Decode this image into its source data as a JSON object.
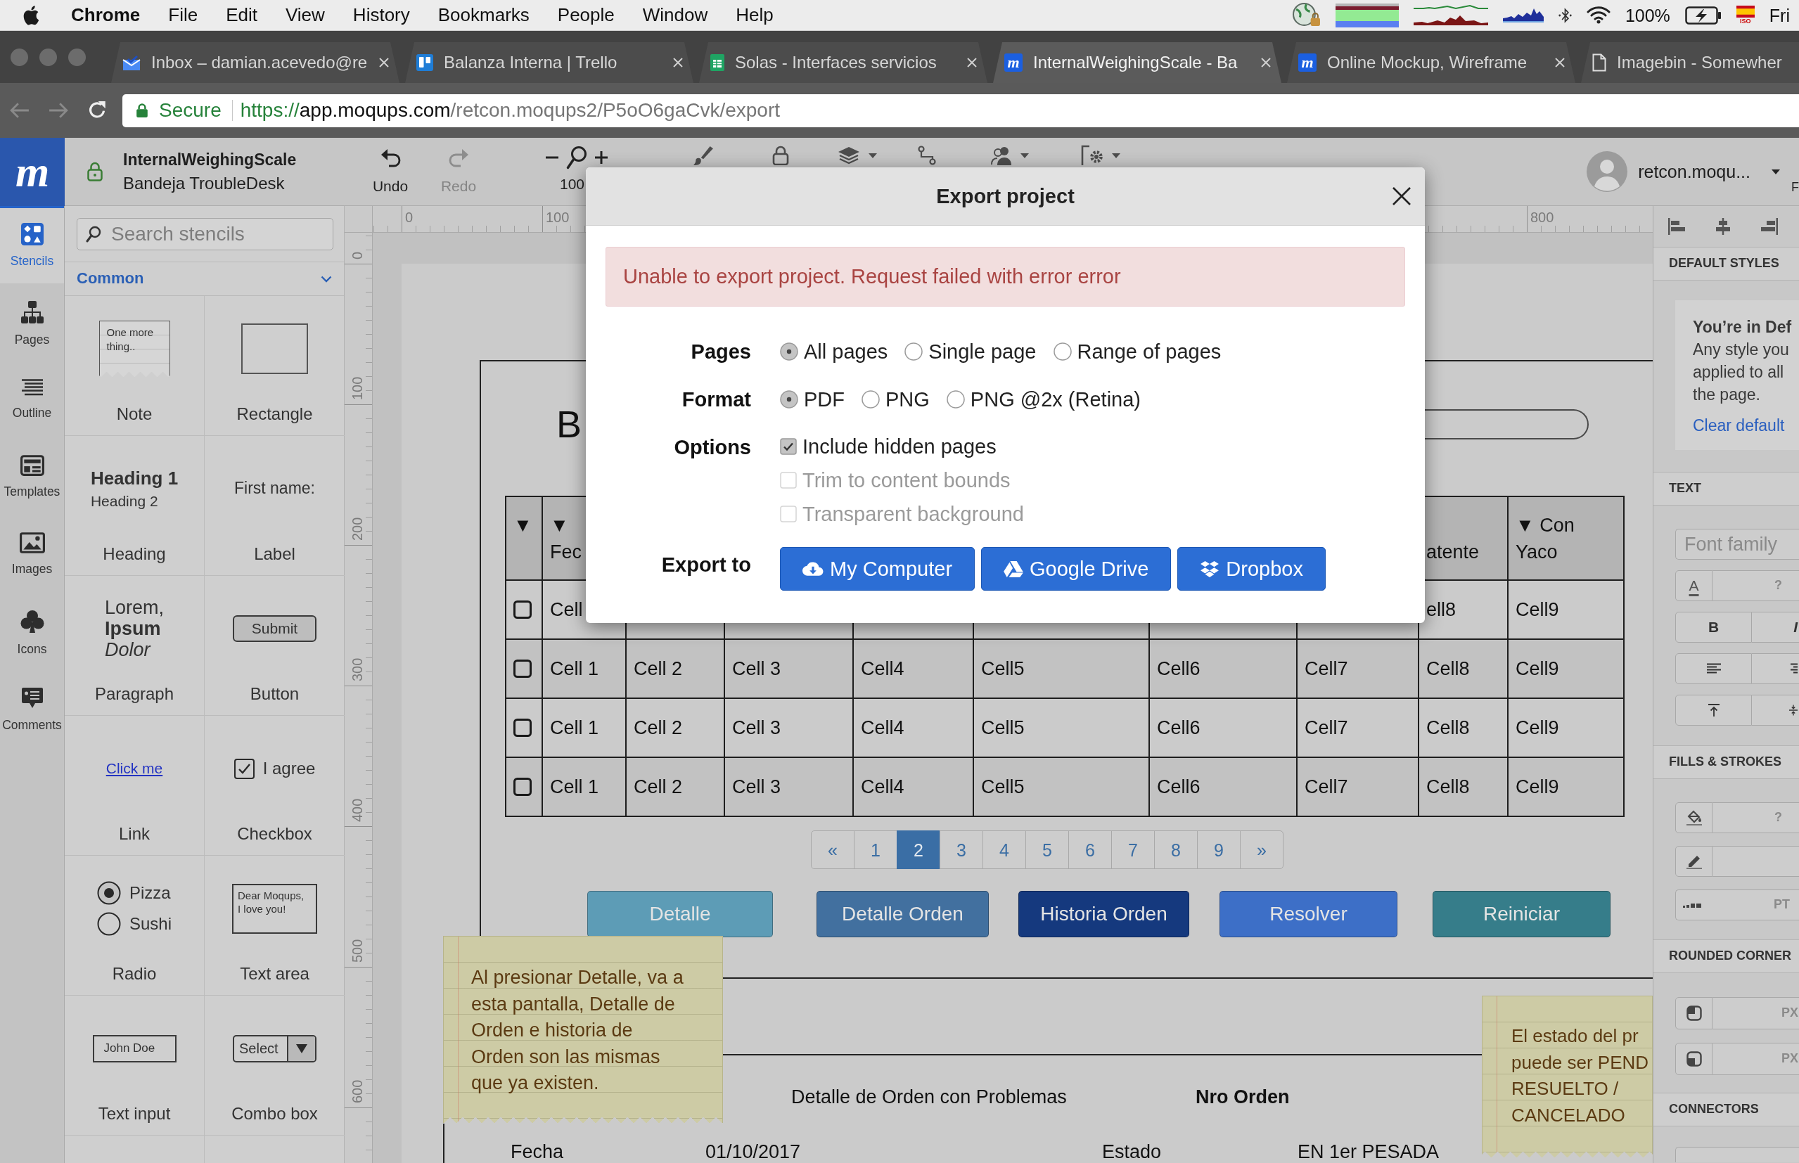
{
  "menu_bar": {
    "app": "Chrome",
    "items": [
      "File",
      "Edit",
      "View",
      "History",
      "Bookmarks",
      "People",
      "Window",
      "Help"
    ],
    "battery": "100%",
    "input_source": "ISO",
    "clock": "Fri"
  },
  "browser": {
    "tabs": [
      {
        "kind": "mail",
        "title": "Inbox – damian.acevedo@re",
        "selected": false,
        "close_button": true
      },
      {
        "kind": "trello",
        "title": "Balanza Interna | Trello",
        "selected": false,
        "close_button": true
      },
      {
        "kind": "sheets",
        "title": "Solas - Interfaces servicios",
        "selected": false,
        "close_button": true
      },
      {
        "kind": "moqups",
        "favicon_text": "m",
        "title": "InternalWeighingScale - Ba",
        "selected": true,
        "close_button": true
      },
      {
        "kind": "moqups",
        "favicon_text": "m",
        "title": "Online Mockup, Wireframe",
        "selected": false,
        "close_button": true
      },
      {
        "kind": "document",
        "title": "Imagebin - Somewher",
        "selected": false,
        "close_button": false
      }
    ],
    "security": "Secure",
    "url": {
      "scheme": "https://",
      "host": "app.moqups.com",
      "path": "/retcon.moqups2/P5oO6gaCvk/export"
    }
  },
  "app_header": {
    "logo": "m",
    "project": "InternalWeighingScale",
    "page": "Bandeja TroubleDesk",
    "history": [
      {
        "kind": "undo",
        "label": "Undo",
        "disabled": false
      },
      {
        "kind": "redo",
        "label": "Redo",
        "disabled": true
      }
    ],
    "zoom": "100",
    "user": "retcon.moqu...",
    "cut_label": "F"
  },
  "sidebar": {
    "items": [
      {
        "kind": "stencils",
        "label": "Stencils",
        "selected": true
      },
      {
        "kind": "pages",
        "label": "Pages",
        "selected": false
      },
      {
        "kind": "outline",
        "label": "Outline",
        "selected": false
      },
      {
        "kind": "templates",
        "label": "Templates",
        "selected": false
      },
      {
        "kind": "images",
        "label": "Images",
        "selected": false
      },
      {
        "kind": "icons",
        "label": "Icons",
        "selected": false
      },
      {
        "kind": "comments",
        "label": "Comments",
        "selected": false
      }
    ]
  },
  "stencils": {
    "search_placeholder": "Search stencils",
    "group": "Common",
    "items": [
      {
        "kind": "note",
        "label": "Note",
        "text": "One more thing.."
      },
      {
        "kind": "rectangle",
        "label": "Rectangle"
      },
      {
        "kind": "heading",
        "label": "Heading",
        "text": "**Heading 1**",
        "subtext": "Heading 2"
      },
      {
        "kind": "label",
        "label": "Label",
        "text": "First name:"
      },
      {
        "kind": "paragraph",
        "label": "Paragraph",
        "text": "Lorem,\n**Ipsum**\n*Dolor*"
      },
      {
        "kind": "button",
        "label": "Button",
        "text": "Submit"
      },
      {
        "kind": "link",
        "label": "Link",
        "text": "Click me"
      },
      {
        "kind": "checkbox",
        "label": "Checkbox",
        "text": "I agree",
        "checked": true
      },
      {
        "kind": "radio",
        "label": "Radio",
        "options": [
          {
            "text": "Pizza",
            "selected": true
          },
          {
            "text": "Sushi",
            "selected": false
          }
        ]
      },
      {
        "kind": "textarea",
        "label": "Text area",
        "text": "Dear Moqups,\nI love you!"
      },
      {
        "kind": "textinput",
        "label": "Text input",
        "value": "John Doe"
      },
      {
        "kind": "combobox",
        "label": "Combo box",
        "text": "Select"
      }
    ]
  },
  "rulers": {
    "horizontal": [
      "0",
      "100",
      "800"
    ],
    "vertical": [
      "0",
      "100",
      "200",
      "300",
      "400",
      "500",
      "600"
    ]
  },
  "canvas": {
    "heading": "B",
    "table": {
      "select_header": "▼",
      "columns": [
        "▼\nFec",
        null,
        null,
        null,
        null,
        null,
        null,
        "\natente",
        "▼ Con\nYaco"
      ],
      "rows": [
        {
          "checked": false,
          "cells": [
            "Cell",
            null,
            null,
            null,
            null,
            null,
            null,
            "ell8",
            "Cell9"
          ]
        },
        {
          "checked": false,
          "cells": [
            "Cell 1",
            "Cell 2",
            "Cell 3",
            "Cell4",
            "Cell5",
            "Cell6",
            "Cell7",
            "Cell8",
            "Cell9"
          ]
        },
        {
          "checked": false,
          "cells": [
            "Cell 1",
            "Cell 2",
            "Cell 3",
            "Cell4",
            "Cell5",
            "Cell6",
            "Cell7",
            "Cell8",
            "Cell9"
          ]
        },
        {
          "checked": false,
          "cells": [
            "Cell 1",
            "Cell 2",
            "Cell 3",
            "Cell4",
            "Cell5",
            "Cell6",
            "Cell7",
            "Cell8",
            "Cell9"
          ]
        }
      ]
    },
    "pagination": [
      {
        "text": "«",
        "selected": false
      },
      {
        "text": "1",
        "selected": false
      },
      {
        "text": "2",
        "selected": true
      },
      {
        "text": "3",
        "selected": false
      },
      {
        "text": "4",
        "selected": false
      },
      {
        "text": "5",
        "selected": false
      },
      {
        "text": "6",
        "selected": false
      },
      {
        "text": "7",
        "selected": false
      },
      {
        "text": "8",
        "selected": false
      },
      {
        "text": "9",
        "selected": false
      },
      {
        "text": "»",
        "selected": false
      }
    ],
    "buttons": [
      {
        "label": "Detalle",
        "color": "#5d9cb6"
      },
      {
        "label": "Detalle Orden",
        "color": "#42709f"
      },
      {
        "label": "Historia Orden",
        "color": "#15397e"
      },
      {
        "label": "Resolver",
        "color": "#3d6fc7"
      },
      {
        "label": "Reiniciar",
        "color": "#367d8a"
      }
    ],
    "notes": [
      {
        "text": "Al presionar Detalle, va a esta pantalla, Detalle de Orden e historia de Orden son las mismas que ya existen."
      },
      {
        "text": "El estado del pr\npuede ser PEND\nRESUELTO /\nCANCELADO"
      }
    ],
    "detail": {
      "title": "Detalle de Orden con Problemas",
      "order_label": "Nro Orden",
      "fields": [
        {
          "label": "Fecha",
          "value": "01/10/2017"
        },
        {
          "label": "Estado",
          "value": "EN 1er PESADA"
        }
      ]
    }
  },
  "inspector": {
    "sections": [
      {
        "kind": "default_styles",
        "title": "DEFAULT STYLES",
        "heading": "You’re in Def",
        "text": "Any style you\napplied to all\nthe page.",
        "link": "Clear default"
      },
      {
        "kind": "text",
        "title": "TEXT",
        "font_placeholder": "Font family",
        "color_glyph": "A",
        "color_value": "?",
        "bold": "B",
        "italic": "I"
      },
      {
        "kind": "fills",
        "title": "FILLS & STROKES",
        "fill_value": "?",
        "line_unit": "PT"
      },
      {
        "kind": "corners",
        "title": "ROUNDED CORNER",
        "units": [
          "PX",
          "PX"
        ]
      },
      {
        "kind": "connectors",
        "title": "CONNECTORS"
      }
    ]
  },
  "modal": {
    "title": "Export project",
    "error": "Unable to export project. Request failed with error error",
    "rows": [
      {
        "kind": "radio",
        "label": "Pages",
        "options": [
          {
            "text": "All pages",
            "selected": true
          },
          {
            "text": "Single page",
            "selected": false
          },
          {
            "text": "Range of pages",
            "selected": false
          }
        ]
      },
      {
        "kind": "radio",
        "label": "Format",
        "options": [
          {
            "text": "PDF",
            "selected": true
          },
          {
            "text": "PNG",
            "selected": false
          },
          {
            "text": "PNG @2x (Retina)",
            "selected": false
          }
        ]
      },
      {
        "kind": "checkbox",
        "label": "Options",
        "options": [
          {
            "text": "Include hidden pages",
            "checked": true,
            "disabled": false
          },
          {
            "text": "Trim to content bounds",
            "checked": false,
            "disabled": true
          },
          {
            "text": "Transparent background",
            "checked": false,
            "disabled": true
          }
        ]
      },
      {
        "kind": "buttons",
        "label": "Export to",
        "options": [
          {
            "kind": "cloud",
            "text": "My Computer"
          },
          {
            "kind": "drive",
            "text": "Google Drive"
          },
          {
            "kind": "dropbox",
            "text": "Dropbox"
          }
        ]
      }
    ]
  }
}
